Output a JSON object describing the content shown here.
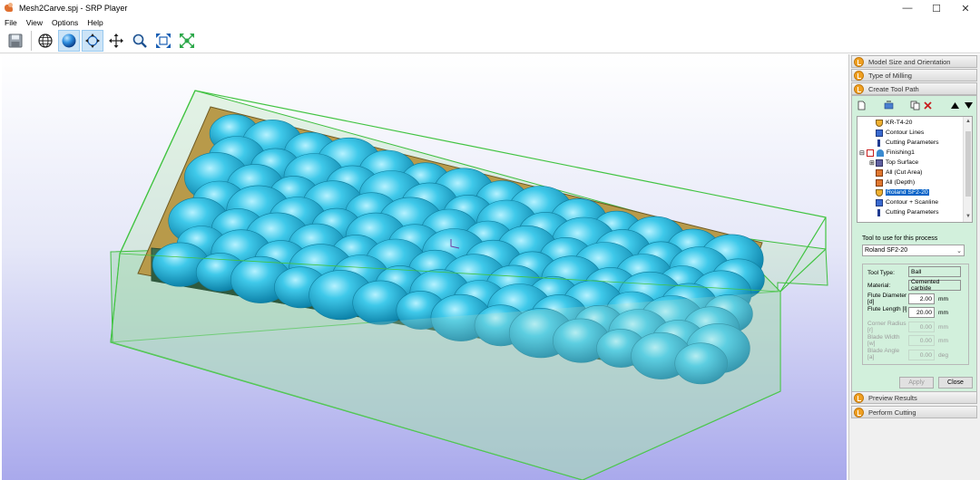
{
  "window": {
    "title": "Mesh2Carve.spj - SRP Player",
    "minimize": "—",
    "maximize": "☐",
    "close": "✕"
  },
  "menu": [
    "File",
    "View",
    "Options",
    "Help"
  ],
  "toolbar": {
    "buttons": [
      "save-icon",
      "globe-icon",
      "sphere-shade-icon",
      "rotate-icon",
      "move-icon",
      "zoom-icon",
      "fit-view-icon",
      "fit-all-icon"
    ],
    "active": "sphere-shade-icon"
  },
  "panel": {
    "sections": {
      "model_size": "Model Size and Orientation",
      "type_of_milling": "Type of Milling",
      "create_tool_path": "Create Tool Path",
      "preview_results": "Preview Results",
      "perform_cutting": "Perform Cutting"
    },
    "tree": [
      {
        "label": "KR-T4-20",
        "icon": "tool-icon"
      },
      {
        "label": "Contour Lines",
        "icon": "contour-icon"
      },
      {
        "label": "Cutting Parameters",
        "icon": "params-icon"
      },
      {
        "label": "Finishing1",
        "icon": "finishing-icon",
        "expander": "⊟"
      },
      {
        "label": "Top Surface",
        "icon": "surface-icon",
        "expander": "⊞"
      },
      {
        "label": "All (Cut Area)",
        "icon": "area-icon"
      },
      {
        "label": "All (Depth)",
        "icon": "depth-icon"
      },
      {
        "label": "Roland SF2-20",
        "icon": "tool-icon",
        "selected": true
      },
      {
        "label": "Contour + Scanline",
        "icon": "contour-icon"
      },
      {
        "label": "Cutting Parameters",
        "icon": "params-icon"
      }
    ],
    "tool_to_use_label": "Tool to use for this process",
    "tool_selected": "Roland SF2-20",
    "props": {
      "tool_type_label": "Tool Type:",
      "tool_type_value": "Ball",
      "material_label": "Material:",
      "material_value": "Cemented carbide",
      "flute_diameter_label": "Flute Diameter [d]",
      "flute_diameter_value": "2.00",
      "flute_length_label": "Flute Length [l]",
      "flute_length_value": "20.00",
      "corner_radius_label": "Corner Radius [r]",
      "corner_radius_value": "0.00",
      "blade_width_label": "Blade Width [w]",
      "blade_width_value": "0.00",
      "blade_angle_label": "Blade Angle [a]",
      "blade_angle_value": "0.00",
      "unit_mm": "mm",
      "unit_deg": "deg"
    },
    "apply": "Apply",
    "close": "Close"
  },
  "colors": {
    "accent_blue": "#0a64c8",
    "panel_green": "#d2f0dc",
    "model_cyan": "#1fb4d6",
    "box_green": "#5ecf5e"
  }
}
